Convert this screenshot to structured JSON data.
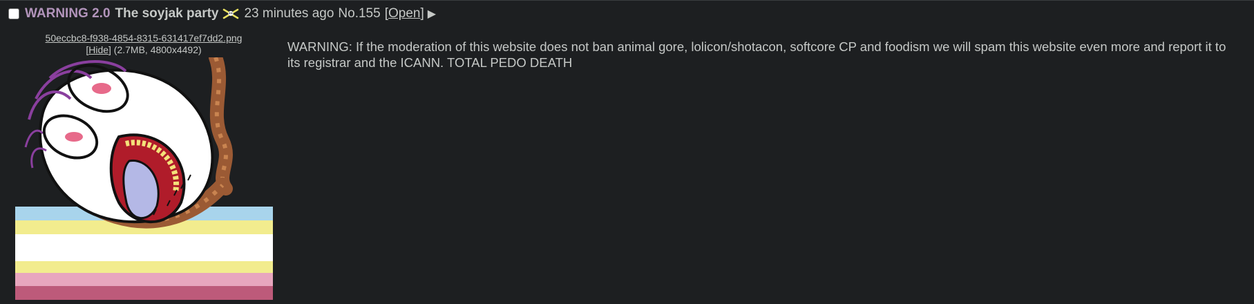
{
  "post": {
    "subject": "WARNING 2.0",
    "name": "The soyjak party",
    "flag_icon": "pirate-flag-icon",
    "time": "23 minutes ago",
    "number": "No.155",
    "open_bracket_left": "[",
    "open_label": "Open",
    "open_bracket_right": "]",
    "arrow_icon": "▶"
  },
  "file": {
    "filename": "50eccbc8-f938-4854-8315-631417ef7dd2.png",
    "hide_bracket_left": "[",
    "hide_label": "Hide",
    "hide_bracket_right": "]",
    "details": "(2.7MB, 4800x4492)"
  },
  "body": {
    "message": "WARNING: If the moderation of this website does not ban animal gore, lolicon/shotacon, softcore CP and foodism we will spam this website even more and report it to its registrar and the ICANN. TOTAL PEDO DEATH"
  },
  "colors": {
    "background": "#1d1f21",
    "text": "#c5c8c6",
    "subject": "#b294bb",
    "stripe_blue": "#a8d4ec",
    "stripe_yellow": "#f2ec8e",
    "stripe_white": "#ffffff",
    "stripe_pink": "#e8a6be",
    "stripe_dark_pink": "#bd5a7a"
  }
}
